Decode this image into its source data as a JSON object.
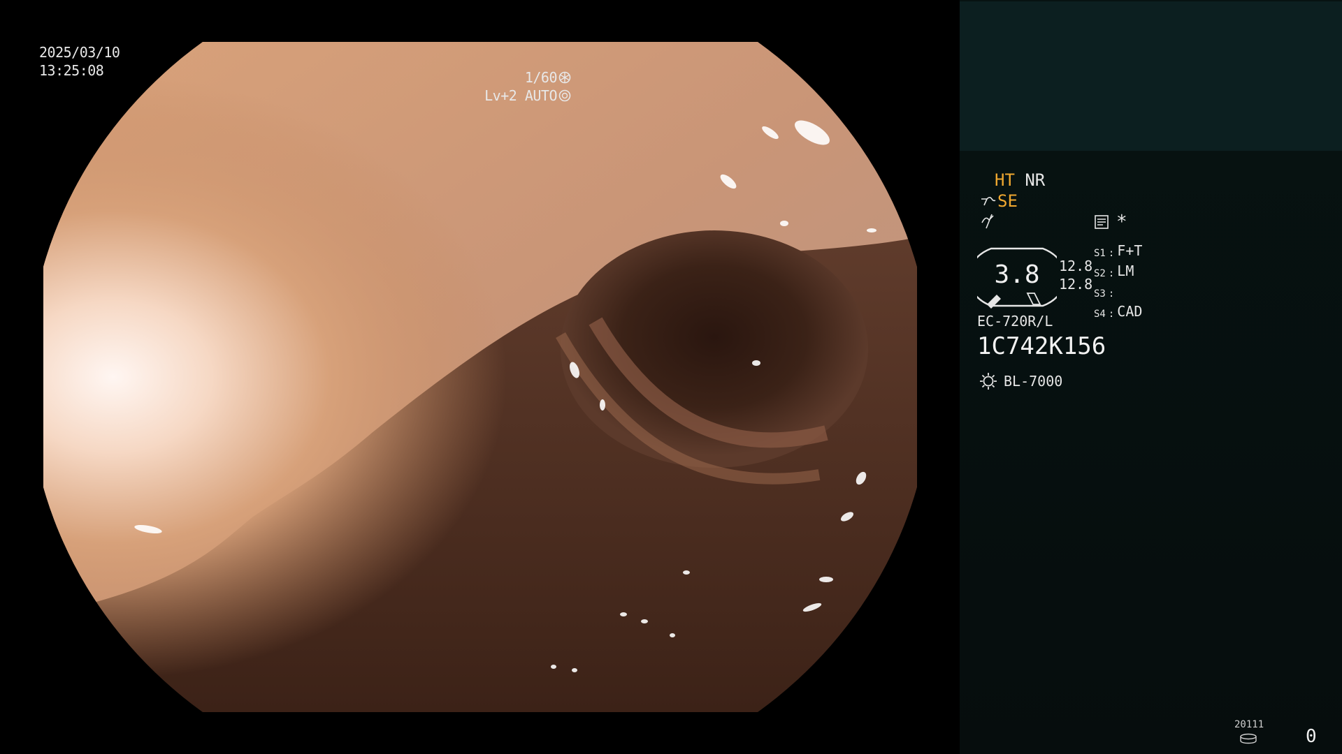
{
  "osd": {
    "date": "2025/03/10",
    "time": "13:25:08",
    "shutter": "1/60",
    "iris": "Lv+2 AUTO",
    "icons": [
      "shutter-icon",
      "iris-icon"
    ]
  },
  "panel": {
    "modes": {
      "ht": "HT",
      "nr": "NR"
    },
    "se_label": "SE",
    "icons": [
      "enhance-icon",
      "modulation-icon",
      "settings-icon",
      "asterisk-icon",
      "light-source-icon",
      "storage-icon"
    ],
    "asterisk": "*",
    "gauge": {
      "value": "3.8",
      "side_top": "12.8",
      "side_bottom": "12.8"
    },
    "switches": [
      {
        "key": "S1",
        "value": "F+T"
      },
      {
        "key": "S2",
        "value": "LM"
      },
      {
        "key": "S3",
        "value": ""
      },
      {
        "key": "S4",
        "value": "CAD"
      }
    ],
    "scope_model": "EC-720R/L",
    "scope_serial": "1C742K156",
    "light_source": "BL-7000",
    "counter_code": "20111",
    "counter_value": "0"
  },
  "colors": {
    "accent_orange": "#f0a830",
    "panel_bg": "#071312",
    "thumb_bg": "#0c1f20"
  }
}
